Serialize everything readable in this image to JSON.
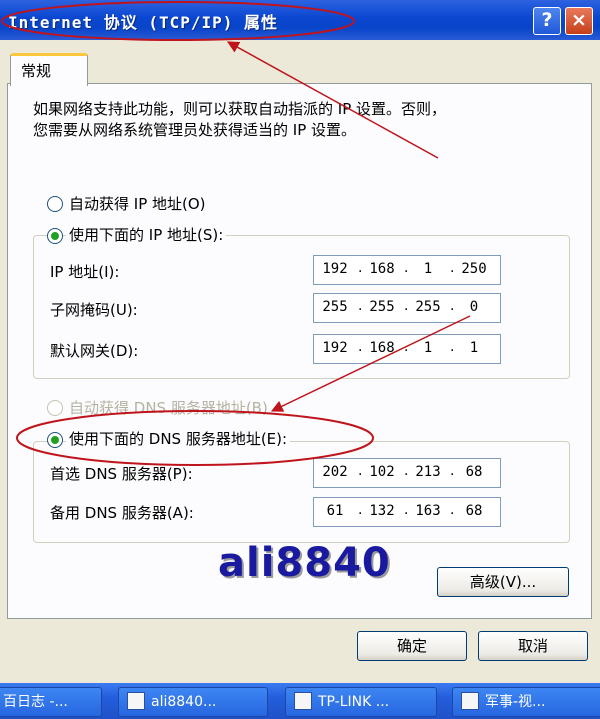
{
  "window": {
    "title": "Internet 协议 (TCP/IP) 属性",
    "help_icon": "?",
    "close_icon": "×"
  },
  "tabs": [
    {
      "label": "常规",
      "active": true
    }
  ],
  "description": [
    "如果网络支持此功能，则可以获取自动指派的 IP 设置。否则，",
    "您需要从网络系统管理员处获得适当的 IP 设置。"
  ],
  "ip_section": {
    "auto_radio": {
      "label": "自动获得 IP 地址(O)",
      "checked": false
    },
    "manual_radio": {
      "label": "使用下面的 IP 地址(S):",
      "checked": true
    },
    "fields": [
      {
        "label": "IP 地址(I):",
        "octets": [
          "192",
          "168",
          "1",
          "250"
        ]
      },
      {
        "label": "子网掩码(U):",
        "octets": [
          "255",
          "255",
          "255",
          "0"
        ]
      },
      {
        "label": "默认网关(D):",
        "octets": [
          "192",
          "168",
          "1",
          "1"
        ]
      }
    ]
  },
  "dns_section": {
    "auto_radio": {
      "label": "自动获得 DNS 服务器地址(B)",
      "checked": false,
      "disabled": true
    },
    "manual_radio": {
      "label": "使用下面的 DNS 服务器地址(E):",
      "checked": true
    },
    "fields": [
      {
        "label": "首选 DNS 服务器(P):",
        "octets": [
          "202",
          "102",
          "213",
          "68"
        ]
      },
      {
        "label": "备用 DNS 服务器(A):",
        "octets": [
          "61",
          "132",
          "163",
          "68"
        ]
      }
    ]
  },
  "watermark": "ali8840",
  "buttons": {
    "advanced": "高级(V)...",
    "ok": "确定",
    "cancel": "取消"
  },
  "taskbar": [
    "百日志 -...",
    "ali8840...",
    "TP-LINK ...",
    "军事-视..."
  ],
  "colors": {
    "annotation": "#c0141c",
    "title_bar": "#0a46d0"
  }
}
